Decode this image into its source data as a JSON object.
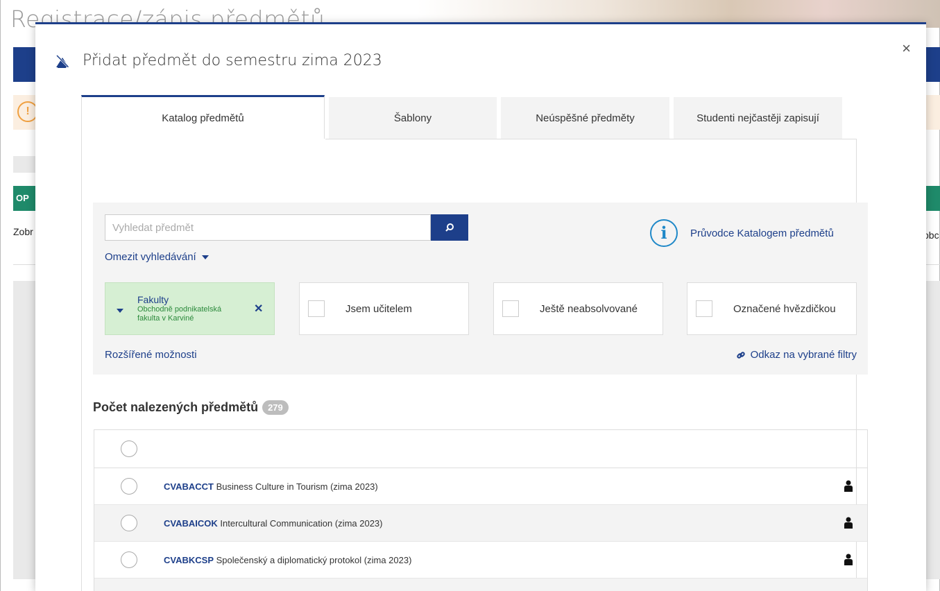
{
  "background": {
    "title": "Registrace/zápis předmětů",
    "green_bar_label": "OP",
    "left_link": "Zobr",
    "right_link": "obc",
    "warn_icon": "exclamation-icon"
  },
  "modal": {
    "title": "Přidat předmět do semestru zima 2023",
    "close_label": "×",
    "header_icon": "course-add-icon"
  },
  "tabs": [
    {
      "label": "Katalog předmětů",
      "active": true
    },
    {
      "label": "Šablony",
      "active": false
    },
    {
      "label": "Neúspěšné předměty",
      "active": false
    },
    {
      "label": "Studenti nejčastěji zapisují",
      "active": false
    }
  ],
  "filters": {
    "search_placeholder": "Vyhledat předmět",
    "search_value": "",
    "restrict_label": "Omezit vyhledávání",
    "guide_label": "Průvodce Katalogem předmětů",
    "faculty": {
      "title": "Fakulty",
      "value": "Obchodně podnikatelská fakulta v Karviné",
      "remove": "✕"
    },
    "checkboxes": [
      {
        "label": "Jsem učitelem",
        "checked": false
      },
      {
        "label": "Ještě neabsolvované",
        "checked": false
      },
      {
        "label": "Označené hvězdičkou",
        "checked": false
      }
    ],
    "extended_label": "Rozšířené možnosti",
    "link_label": "Odkaz na vybrané filtry"
  },
  "results": {
    "count_label": "Počet nalezených předmětů",
    "count": "279",
    "rows": [
      {
        "code": "CVABACCT",
        "name": "Business Culture in Tourism (zima 2023)"
      },
      {
        "code": "CVABAICOK",
        "name": "Intercultural Communication (zima 2023)"
      },
      {
        "code": "CVABKCSP",
        "name": "Společenský a diplomatický protokol (zima 2023)"
      }
    ]
  },
  "colors": {
    "primary": "#1d3f8a",
    "green": "#1f8a6a",
    "faculty_bg": "#d6efd3",
    "info": "#1e88c8"
  }
}
